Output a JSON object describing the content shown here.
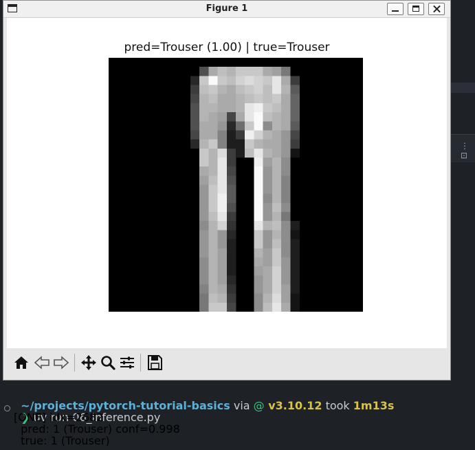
{
  "window": {
    "title": "Figure 1",
    "buttons": {
      "minimize": "minimize",
      "maximize": "maximize",
      "close": "close"
    }
  },
  "figure": {
    "title": "pred=Trouser (1.00) | true=Trouser",
    "image": {
      "width": 28,
      "height": 28,
      "pixels": [
        [
          0,
          0,
          0,
          0,
          0,
          0,
          0,
          0,
          0,
          0,
          0,
          0,
          0,
          0,
          0,
          0,
          0,
          0,
          0,
          0,
          0,
          0,
          0,
          0,
          0,
          0,
          0,
          0
        ],
        [
          0,
          0,
          0,
          0,
          0,
          0,
          0,
          0,
          0,
          0,
          80,
          170,
          190,
          180,
          200,
          200,
          200,
          170,
          160,
          120,
          0,
          0,
          0,
          0,
          0,
          0,
          0,
          0
        ],
        [
          0,
          0,
          0,
          0,
          0,
          0,
          0,
          0,
          0,
          40,
          200,
          250,
          200,
          190,
          210,
          220,
          210,
          200,
          230,
          170,
          60,
          0,
          0,
          0,
          0,
          0,
          0,
          0
        ],
        [
          0,
          0,
          0,
          0,
          0,
          0,
          0,
          0,
          0,
          60,
          190,
          200,
          180,
          170,
          190,
          200,
          210,
          190,
          230,
          180,
          90,
          0,
          0,
          0,
          0,
          0,
          0,
          0
        ],
        [
          0,
          0,
          0,
          0,
          0,
          0,
          0,
          0,
          0,
          70,
          180,
          190,
          170,
          170,
          180,
          190,
          200,
          190,
          200,
          170,
          100,
          0,
          0,
          0,
          0,
          0,
          0,
          0
        ],
        [
          0,
          0,
          0,
          0,
          0,
          0,
          0,
          0,
          0,
          80,
          180,
          180,
          170,
          170,
          180,
          230,
          240,
          200,
          190,
          170,
          100,
          0,
          0,
          0,
          0,
          0,
          0,
          0
        ],
        [
          0,
          0,
          0,
          0,
          0,
          0,
          0,
          0,
          0,
          80,
          180,
          170,
          160,
          70,
          170,
          230,
          250,
          190,
          180,
          170,
          100,
          0,
          0,
          0,
          0,
          0,
          0,
          0
        ],
        [
          0,
          0,
          0,
          0,
          0,
          0,
          0,
          0,
          0,
          80,
          170,
          170,
          150,
          40,
          110,
          200,
          250,
          140,
          180,
          170,
          90,
          0,
          0,
          0,
          0,
          0,
          0,
          0
        ],
        [
          0,
          0,
          0,
          0,
          0,
          0,
          0,
          0,
          0,
          70,
          170,
          170,
          130,
          30,
          60,
          240,
          210,
          180,
          170,
          150,
          70,
          0,
          0,
          0,
          0,
          0,
          0,
          0
        ],
        [
          0,
          0,
          0,
          0,
          0,
          0,
          0,
          0,
          0,
          40,
          180,
          200,
          130,
          30,
          30,
          200,
          180,
          170,
          170,
          150,
          60,
          0,
          0,
          0,
          0,
          0,
          0,
          0
        ],
        [
          0,
          0,
          0,
          0,
          0,
          0,
          0,
          0,
          0,
          0,
          200,
          180,
          220,
          60,
          30,
          190,
          230,
          180,
          170,
          150,
          20,
          0,
          0,
          0,
          0,
          0,
          0,
          0
        ],
        [
          0,
          0,
          0,
          0,
          0,
          0,
          0,
          0,
          0,
          0,
          200,
          180,
          230,
          60,
          0,
          0,
          240,
          160,
          180,
          140,
          0,
          0,
          0,
          0,
          0,
          0,
          0,
          0
        ],
        [
          0,
          0,
          0,
          0,
          0,
          0,
          0,
          0,
          0,
          0,
          170,
          180,
          230,
          70,
          0,
          0,
          250,
          150,
          180,
          140,
          0,
          0,
          0,
          0,
          0,
          0,
          0,
          0
        ],
        [
          0,
          0,
          0,
          0,
          0,
          0,
          0,
          0,
          0,
          0,
          160,
          190,
          230,
          80,
          0,
          0,
          250,
          150,
          180,
          130,
          0,
          0,
          0,
          0,
          0,
          0,
          0,
          0
        ],
        [
          0,
          0,
          0,
          0,
          0,
          0,
          0,
          0,
          0,
          0,
          150,
          200,
          230,
          90,
          0,
          0,
          250,
          150,
          180,
          130,
          0,
          0,
          0,
          0,
          0,
          0,
          0,
          0
        ],
        [
          0,
          0,
          0,
          0,
          0,
          0,
          0,
          0,
          0,
          0,
          150,
          200,
          240,
          90,
          0,
          0,
          250,
          140,
          180,
          130,
          0,
          0,
          0,
          0,
          0,
          0,
          0,
          0
        ],
        [
          0,
          0,
          0,
          0,
          0,
          0,
          0,
          0,
          0,
          0,
          150,
          200,
          240,
          80,
          0,
          0,
          250,
          150,
          190,
          140,
          0,
          0,
          0,
          0,
          0,
          0,
          0,
          0
        ],
        [
          0,
          0,
          0,
          0,
          0,
          0,
          0,
          0,
          0,
          0,
          150,
          190,
          230,
          60,
          0,
          0,
          250,
          150,
          180,
          120,
          0,
          0,
          0,
          0,
          0,
          0,
          0,
          0
        ],
        [
          0,
          0,
          0,
          0,
          0,
          0,
          0,
          0,
          0,
          0,
          140,
          180,
          210,
          50,
          0,
          0,
          230,
          180,
          190,
          140,
          30,
          0,
          0,
          0,
          0,
          0,
          0,
          0
        ],
        [
          0,
          0,
          0,
          0,
          0,
          0,
          0,
          0,
          0,
          0,
          150,
          180,
          150,
          40,
          0,
          0,
          200,
          150,
          180,
          140,
          20,
          0,
          0,
          0,
          0,
          0,
          0,
          0
        ],
        [
          0,
          0,
          0,
          0,
          0,
          0,
          0,
          0,
          0,
          0,
          150,
          180,
          150,
          30,
          0,
          0,
          200,
          150,
          190,
          140,
          30,
          0,
          0,
          0,
          0,
          0,
          0,
          0
        ],
        [
          0,
          0,
          0,
          0,
          0,
          0,
          0,
          0,
          0,
          0,
          150,
          180,
          160,
          30,
          0,
          0,
          180,
          160,
          200,
          140,
          30,
          0,
          0,
          0,
          0,
          0,
          0,
          0
        ],
        [
          0,
          0,
          0,
          0,
          0,
          0,
          0,
          0,
          0,
          0,
          140,
          180,
          160,
          30,
          0,
          0,
          170,
          160,
          200,
          150,
          30,
          0,
          0,
          0,
          0,
          0,
          0,
          0
        ],
        [
          0,
          0,
          0,
          0,
          0,
          0,
          0,
          0,
          0,
          0,
          140,
          180,
          160,
          30,
          0,
          0,
          160,
          170,
          210,
          150,
          30,
          0,
          0,
          0,
          0,
          0,
          0,
          0
        ],
        [
          0,
          0,
          0,
          0,
          0,
          0,
          0,
          0,
          0,
          0,
          140,
          180,
          160,
          40,
          0,
          0,
          150,
          170,
          210,
          150,
          30,
          0,
          0,
          0,
          0,
          0,
          0,
          0
        ],
        [
          0,
          0,
          0,
          0,
          0,
          0,
          0,
          0,
          0,
          0,
          130,
          180,
          170,
          50,
          0,
          0,
          150,
          170,
          210,
          160,
          30,
          0,
          0,
          0,
          0,
          0,
          0,
          0
        ],
        [
          0,
          0,
          0,
          0,
          0,
          0,
          0,
          0,
          0,
          0,
          120,
          190,
          180,
          60,
          0,
          0,
          140,
          180,
          220,
          160,
          20,
          0,
          0,
          0,
          0,
          0,
          0,
          0
        ],
        [
          0,
          0,
          0,
          0,
          0,
          0,
          0,
          0,
          0,
          0,
          120,
          200,
          200,
          70,
          0,
          0,
          140,
          190,
          230,
          170,
          20,
          0,
          0,
          0,
          0,
          0,
          0,
          0
        ]
      ]
    }
  },
  "toolbar": {
    "icons": [
      "home-icon",
      "back-icon",
      "forward-icon",
      "pan-icon",
      "zoom-icon",
      "configure-subplots-icon",
      "save-icon"
    ]
  },
  "terminal": {
    "line1": {
      "path": "~/projects/pytorch-tutorial-basics",
      "via": " via ",
      "python_symbol": "@",
      "version": " v3.10.12",
      "took_label": " took ",
      "took": "1m13s"
    },
    "line2": {
      "arrow": "❯",
      "command": " uv run 06_inference.py"
    },
    "line3": "[ONE] idx=2682",
    "line4": "  pred: 1 (Trouser) conf=0.998",
    "line5": "  true: 1 (Trouser)"
  },
  "colors": {
    "terminal_bg": "#1e2227",
    "path": "#5fb0d6",
    "version": "#d8c24a",
    "prompt": "#3fbf7f"
  }
}
